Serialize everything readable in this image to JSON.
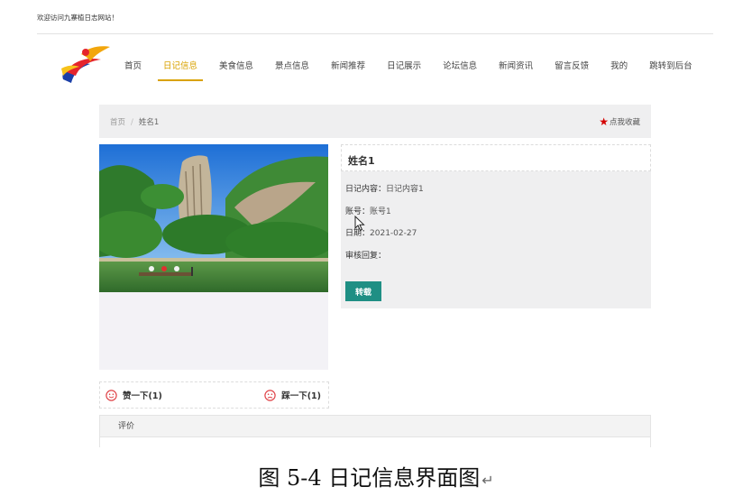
{
  "header": {
    "welcome": "欢迎访问九寨植日志网站！"
  },
  "nav": {
    "items": [
      {
        "label": "首页"
      },
      {
        "label": "日记信息"
      },
      {
        "label": "美食信息"
      },
      {
        "label": "景点信息"
      },
      {
        "label": "新闻推荐"
      },
      {
        "label": "日记展示"
      },
      {
        "label": "论坛信息"
      },
      {
        "label": "新闻资讯"
      },
      {
        "label": "留言反馈"
      },
      {
        "label": "我的"
      },
      {
        "label": "跳转到后台"
      }
    ],
    "active_index": 1,
    "active_color": "#d9a200"
  },
  "breadcrumb": {
    "home": "首页",
    "separator": "/",
    "current": "姓名1"
  },
  "favorite": {
    "icon": "star-icon",
    "label": "点我收藏",
    "color": "#d40000"
  },
  "detail": {
    "title": "姓名1",
    "content_label": "日记内容：",
    "content_value": "日记内容1",
    "account_label": "账号：",
    "account_value": "账号1",
    "date_label": "日期：",
    "date_value": "2021-02-27",
    "review_label": "审核回复：",
    "review_value": "",
    "share_button": "转载",
    "share_button_color": "#1f8f84"
  },
  "votes": {
    "like_label": "赞一下(1)",
    "dislike_label": "踩一下(1)",
    "icon_color": "#e0454a"
  },
  "comments": {
    "header": "评价"
  },
  "caption": {
    "text": "图 5-4 日记信息界面图",
    "mark": "↵"
  }
}
